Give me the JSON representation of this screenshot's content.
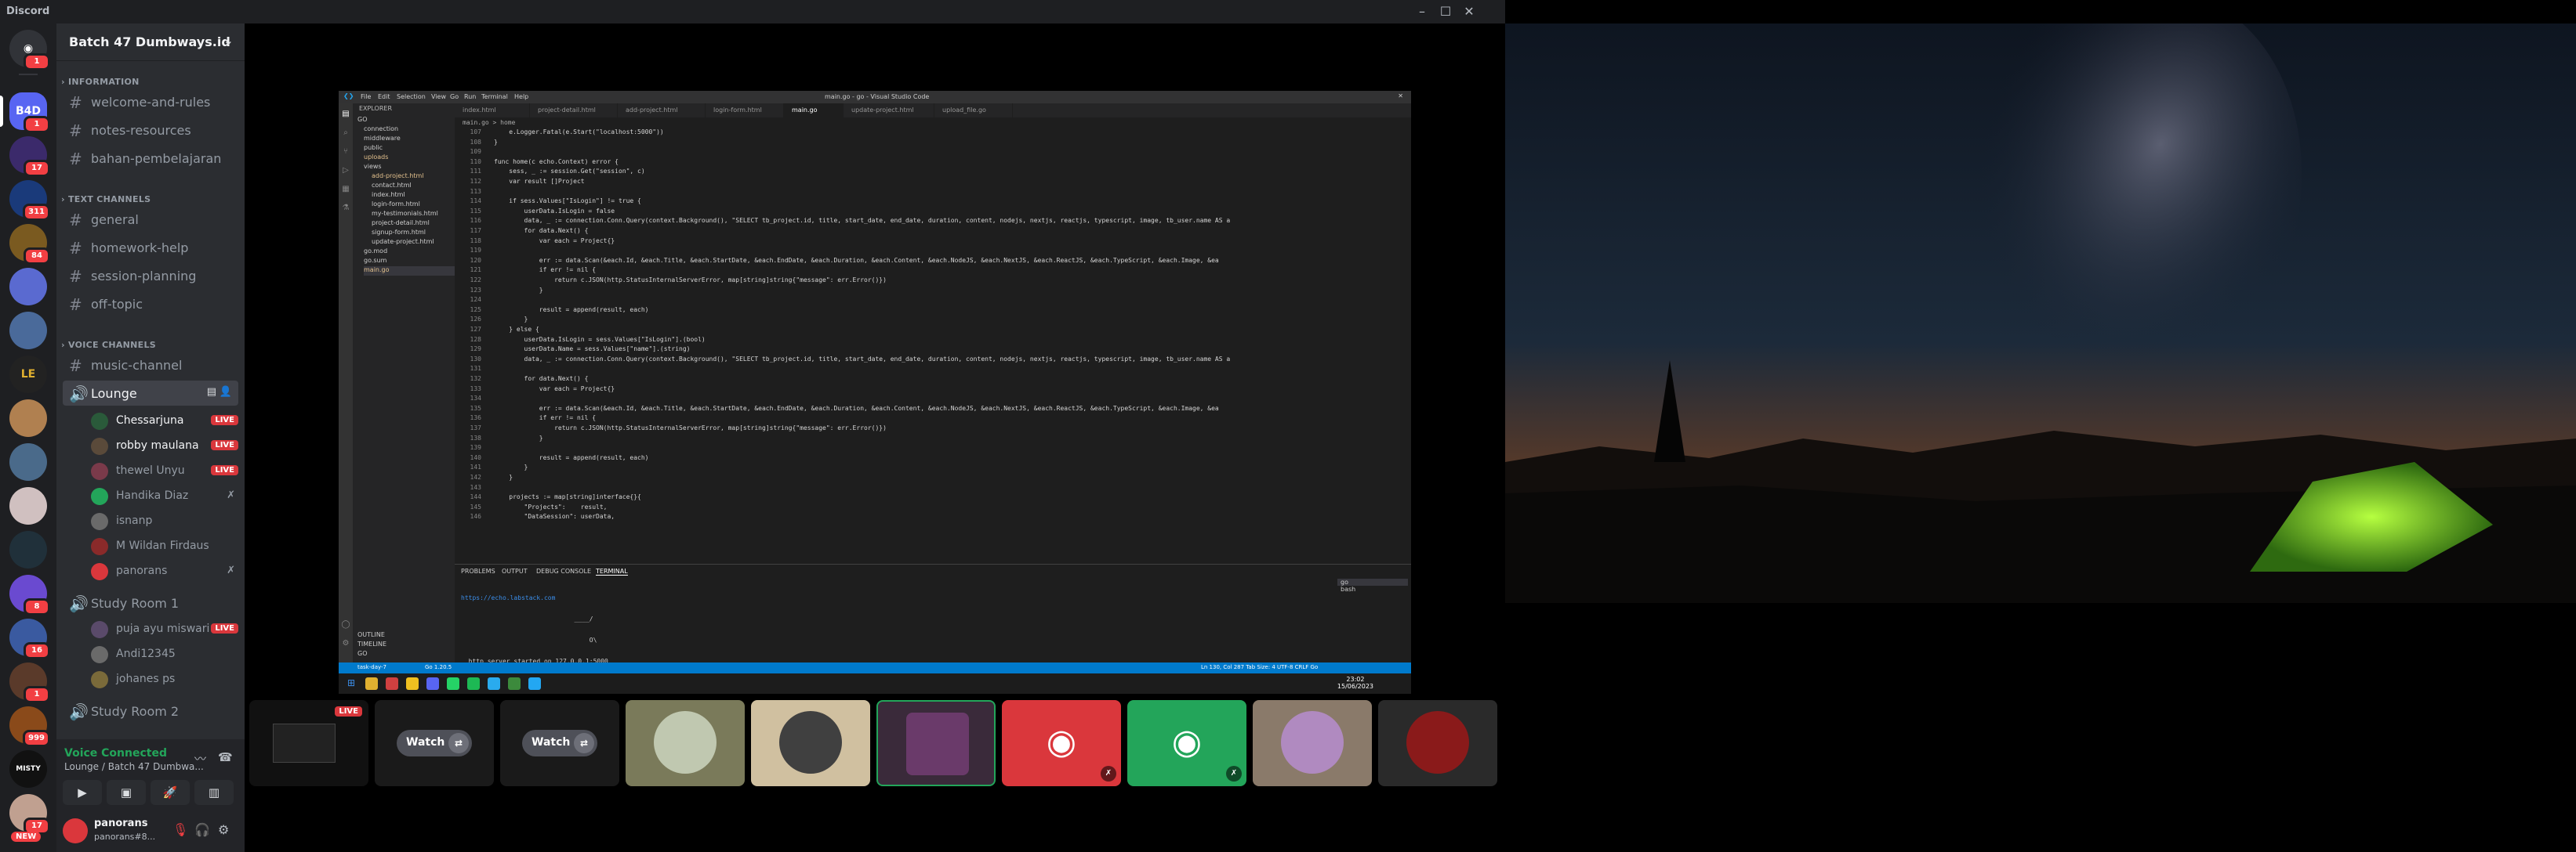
{
  "titlebar": {
    "app": "Discord"
  },
  "rail": {
    "servers": [
      {
        "badge": "1"
      },
      {
        "label": "B4D",
        "badge": "1"
      },
      {
        "badge": "17"
      },
      {
        "badge": "311"
      },
      {
        "badge": "84"
      },
      {
        "badge": ""
      },
      {
        "badge": ""
      },
      {
        "badge": ""
      },
      {
        "badge": ""
      },
      {
        "badge": ""
      },
      {
        "badge": ""
      },
      {
        "badge": ""
      },
      {
        "badge": "8"
      },
      {
        "badge": "16"
      },
      {
        "badge": "1"
      },
      {
        "badge": "999"
      },
      {
        "label": "MISTY",
        "badge": ""
      },
      {
        "badge": "17"
      }
    ],
    "new_label": "NEW"
  },
  "guild": {
    "name": "Batch 47 Dumbways.id",
    "categories": {
      "information": "INFORMATION",
      "text": "TEXT CHANNELS",
      "voice": "VOICE CHANNELS"
    },
    "info_channels": [
      "welcome-and-rules",
      "notes-resources",
      "bahan-pembelajaran"
    ],
    "text_channels": [
      "general",
      "homework-help",
      "session-planning",
      "off-topic"
    ],
    "voice_channels": {
      "music": "music-channel",
      "lounge": "Lounge",
      "study1": "Study Room 1",
      "study2": "Study Room 2"
    },
    "lounge_users": [
      {
        "name": "Chessarjuna",
        "status": "LIVE"
      },
      {
        "name": "robby maulana",
        "status": "LIVE"
      },
      {
        "name": "thewel Unyu",
        "status": "LIVE"
      },
      {
        "name": "Handika Diaz",
        "status": ""
      },
      {
        "name": "isnanp",
        "status": ""
      },
      {
        "name": "M Wildan Firdaus",
        "status": ""
      },
      {
        "name": "panorans",
        "status": ""
      }
    ],
    "study1_users": [
      {
        "name": "puja ayu miswari",
        "status": "LIVE"
      },
      {
        "name": "Andi12345",
        "status": ""
      },
      {
        "name": "johanes ps",
        "status": ""
      }
    ]
  },
  "voice": {
    "status": "Voice Connected",
    "location": "Lounge / Batch 47 Dumbwa..."
  },
  "user": {
    "name": "panorans",
    "tag": "panorans#8..."
  },
  "strip": {
    "watch_label": "Watch",
    "live_label": "LIVE"
  },
  "vscode": {
    "menu": [
      "File",
      "Edit",
      "Selection",
      "View",
      "Go",
      "Run",
      "Terminal",
      "Help"
    ],
    "window_title": "main.go - go - Visual Studio Code",
    "explorer_title": "EXPLORER",
    "tree": [
      "GO",
      "connection",
      "middleware",
      "public",
      "uploads",
      "views",
      "add-project.html",
      "contact.html",
      "index.html",
      "login-form.html",
      "my-testimonials.html",
      "project-detail.html",
      "signup-form.html",
      "update-project.html",
      "go.mod",
      "go.sum",
      "main.go",
      "OUTLINE",
      "TIMELINE",
      "GO"
    ],
    "tabs": [
      "index.html",
      "project-detail.html",
      "add-project.html",
      "login-form.html",
      "main.go",
      "update-project.html",
      "upload_file.go"
    ],
    "breadcrumb": "main.go > home",
    "code": [
      {
        "n": "107",
        "t": "    e.Logger.Fatal(e.Start(\"localhost:5000\"))"
      },
      {
        "n": "108",
        "t": "}"
      },
      {
        "n": "109",
        "t": ""
      },
      {
        "n": "110",
        "t": "func home(c echo.Context) error {"
      },
      {
        "n": "111",
        "t": "    sess, _ := session.Get(\"session\", c)"
      },
      {
        "n": "112",
        "t": "    var result []Project"
      },
      {
        "n": "113",
        "t": ""
      },
      {
        "n": "114",
        "t": "    if sess.Values[\"IsLogin\"] != true {"
      },
      {
        "n": "115",
        "t": "        userData.IsLogin = false"
      },
      {
        "n": "116",
        "t": "        data, _ := connection.Conn.Query(context.Background(), \"SELECT tb_project.id, title, start_date, end_date, duration, content, nodejs, nextjs, reactjs, typescript, image, tb_user.name AS a"
      },
      {
        "n": "117",
        "t": "        for data.Next() {"
      },
      {
        "n": "118",
        "t": "            var each = Project{}"
      },
      {
        "n": "119",
        "t": ""
      },
      {
        "n": "120",
        "t": "            err := data.Scan(&each.Id, &each.Title, &each.StartDate, &each.EndDate, &each.Duration, &each.Content, &each.NodeJS, &each.NextJS, &each.ReactJS, &each.TypeScript, &each.Image, &ea"
      },
      {
        "n": "121",
        "t": "            if err != nil {"
      },
      {
        "n": "122",
        "t": "                return c.JSON(http.StatusInternalServerError, map[string]string{\"message\": err.Error()})"
      },
      {
        "n": "123",
        "t": "            }"
      },
      {
        "n": "124",
        "t": ""
      },
      {
        "n": "125",
        "t": "            result = append(result, each)"
      },
      {
        "n": "126",
        "t": "        }"
      },
      {
        "n": "127",
        "t": "    } else {"
      },
      {
        "n": "128",
        "t": "        userData.IsLogin = sess.Values[\"IsLogin\"].(bool)"
      },
      {
        "n": "129",
        "t": "        userData.Name = sess.Values[\"name\"].(string)"
      },
      {
        "n": "130",
        "t": "        data, _ := connection.Conn.Query(context.Background(), \"SELECT tb_project.id, title, start_date, end_date, duration, content, nodejs, nextjs, reactjs, typescript, image, tb_user.name AS a"
      },
      {
        "n": "131",
        "t": ""
      },
      {
        "n": "132",
        "t": "        for data.Next() {"
      },
      {
        "n": "133",
        "t": "            var each = Project{}"
      },
      {
        "n": "134",
        "t": ""
      },
      {
        "n": "135",
        "t": "            err := data.Scan(&each.Id, &each.Title, &each.StartDate, &each.EndDate, &each.Duration, &each.Content, &each.NodeJS, &each.NextJS, &each.ReactJS, &each.TypeScript, &each.Image, &ea"
      },
      {
        "n": "136",
        "t": "            if err != nil {"
      },
      {
        "n": "137",
        "t": "                return c.JSON(http.StatusInternalServerError, map[string]string{\"message\": err.Error()})"
      },
      {
        "n": "138",
        "t": "            }"
      },
      {
        "n": "139",
        "t": ""
      },
      {
        "n": "140",
        "t": "            result = append(result, each)"
      },
      {
        "n": "141",
        "t": "        }"
      },
      {
        "n": "142",
        "t": "    }"
      },
      {
        "n": "143",
        "t": ""
      },
      {
        "n": "144",
        "t": "    projects := map[string]interface{}{"
      },
      {
        "n": "145",
        "t": "        \"Projects\":    result,"
      },
      {
        "n": "146",
        "t": "        \"DataSession\": userData,"
      }
    ],
    "panel_tabs": [
      "PROBLEMS",
      "OUTPUT",
      "DEBUG CONSOLE",
      "TERMINAL"
    ],
    "terminal_lines": [
      "https://echo.labstack.com",
      "                              ____/",
      "                                  O\\",
      "  http server started on 127.0.0.1:5000"
    ],
    "terminal_list": [
      "go",
      "bash"
    ],
    "status_left": "task-day-7",
    "status_version": "Go 1.20.5",
    "status_right": "Ln 130, Col 287   Tab Size: 4   UTF-8   CRLF   Go",
    "clock_time": "23:02",
    "clock_date": "15/06/2023"
  }
}
